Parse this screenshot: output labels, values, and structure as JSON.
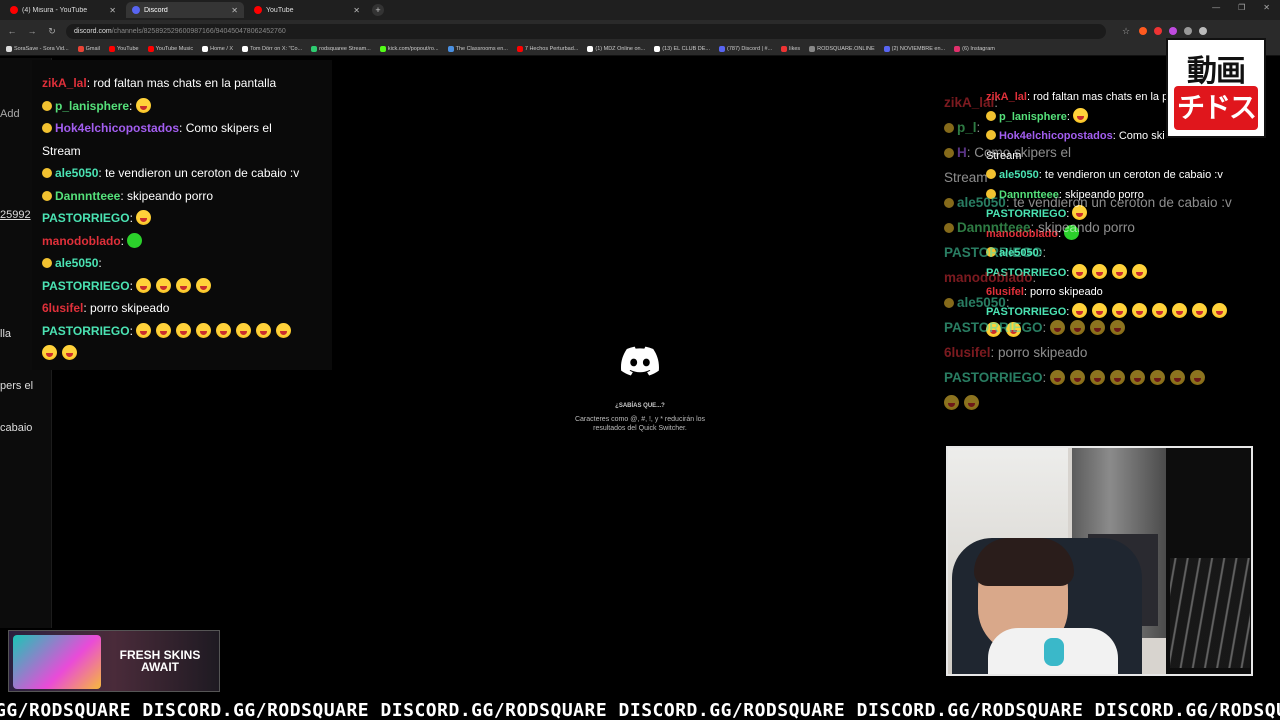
{
  "browser": {
    "tabs": [
      {
        "title": "(4) Misura - YouTube",
        "color": "#ff0000",
        "active": false
      },
      {
        "title": "Discord",
        "color": "#5865f2",
        "active": true
      },
      {
        "title": "YouTube",
        "color": "#ff0000",
        "active": false
      }
    ],
    "url_host": "discord.com",
    "url_path": "/channels/825892529600987166/940450478062452760",
    "bookmarks": [
      "SoraSave - Sora Vid...",
      "Gmail",
      "YouTube",
      "YouTube Music",
      "Home / X",
      "Tom Dörr on X: \"Co...",
      "rodsquaree Stream...",
      "kick.com/popout/ro...",
      "The Classrooms en...",
      "7 Hechos Perturbad...",
      "(1) MDZ Online on...",
      "(13) EL CLUB DE...",
      "(787) Discord | #...",
      "likes",
      "RODSQUARE.ONLINE",
      "(2) NOVIEMBRE en...",
      "(6) Instagram"
    ]
  },
  "left_strip": {
    "items": [
      "Add",
      "25992",
      "lla",
      "pers el",
      "cabaio"
    ]
  },
  "chat_left": [
    {
      "user": "zikA_lal",
      "color": "#e0303a",
      "badge": false,
      "msg": "rod faltan mas chats en la pantalla",
      "emotes": 0
    },
    {
      "user": "p_lanisphere",
      "color": "#55e07a",
      "badge": true,
      "msg": "",
      "emotes": 1
    },
    {
      "user": "Hok4elchicopostados",
      "color": "#a35ef0",
      "badge": true,
      "msg": "Como skipers el",
      "emotes": 0
    },
    {
      "user": "",
      "color": "#fff",
      "badge": false,
      "msg": "Stream",
      "emotes": 0
    },
    {
      "user": "ale5050",
      "color": "#4be3b3",
      "badge": true,
      "msg": "te vendieron un ceroton de cabaio :v",
      "emotes": 0
    },
    {
      "user": "Dannntteee",
      "color": "#55e07a",
      "badge": true,
      "msg": "skipeando porro",
      "emotes": 0
    },
    {
      "user": "PASTORRIEGO",
      "color": "#4be3b3",
      "badge": false,
      "msg": "",
      "emotes": 1
    },
    {
      "user": "manodoblado",
      "color": "#e0303a",
      "badge": false,
      "msg": "",
      "emotes": 1,
      "green": true
    },
    {
      "user": "ale5050",
      "color": "#4be3b3",
      "badge": true,
      "msg": "",
      "emotes": 0
    },
    {
      "user": "PASTORRIEGO",
      "color": "#4be3b3",
      "badge": false,
      "msg": "",
      "emotes": 4
    },
    {
      "user": "6lusifel",
      "color": "#e0303a",
      "badge": false,
      "msg": "porro skipeado",
      "emotes": 0
    },
    {
      "user": "PASTORRIEGO",
      "color": "#4be3b3",
      "badge": false,
      "msg": "",
      "emotes": 8
    },
    {
      "user": "",
      "color": "#fff",
      "badge": false,
      "msg": "",
      "emotes": 2
    }
  ],
  "discord": {
    "tip_title": "¿SABÍAS QUE...?",
    "tip_body": "Caracteres como @, #, !, y * reducirán los resultados del Quick Switcher."
  },
  "chat_right": [
    {
      "user": "zikA_lal",
      "color": "#e0303a",
      "badge": false,
      "msg": "",
      "emotes": 0
    },
    {
      "user": "p_l",
      "color": "#55e07a",
      "badge": true,
      "msg": "",
      "emotes": 0
    },
    {
      "user": "H",
      "color": "#a35ef0",
      "badge": true,
      "msg": "Como skipers el",
      "emotes": 0
    },
    {
      "user": "",
      "color": "#fff",
      "badge": false,
      "msg": "Stream",
      "emotes": 0
    },
    {
      "user": "ale5050",
      "color": "#4be3b3",
      "badge": true,
      "msg": "te vendieron un ceroton de cabaio :v",
      "emotes": 0
    },
    {
      "user": "Dannntteee",
      "color": "#55e07a",
      "badge": true,
      "msg": "skipeando porro",
      "emotes": 0
    },
    {
      "user": "PASTORRIEGO",
      "color": "#4be3b3",
      "badge": false,
      "msg": "",
      "emotes": 0
    },
    {
      "user": "manodoblado",
      "color": "#e0303a",
      "badge": false,
      "msg": "",
      "emotes": 0
    },
    {
      "user": "ale5050",
      "color": "#4be3b3",
      "badge": true,
      "msg": "",
      "emotes": 0
    },
    {
      "user": "PASTORRIEGO",
      "color": "#4be3b3",
      "badge": false,
      "msg": "",
      "emotes": 4
    },
    {
      "user": "6lusifel",
      "color": "#e0303a",
      "badge": false,
      "msg": "porro skipeado",
      "emotes": 0
    },
    {
      "user": "PASTORRIEGO",
      "color": "#4be3b3",
      "badge": false,
      "msg": "",
      "emotes": 8
    },
    {
      "user": "",
      "color": "#fff",
      "badge": false,
      "msg": "",
      "emotes": 2
    }
  ],
  "chat_ghost": [
    {
      "user": "zikA_lal",
      "color": "#e0303a",
      "badge": false,
      "msg": "rod faltan mas chats en la pa",
      "emotes": 0
    },
    {
      "user": "p_lanisphere",
      "color": "#55e07a",
      "badge": true,
      "msg": "",
      "emotes": 1
    },
    {
      "user": "Hok4elchicopostados",
      "color": "#a35ef0",
      "badge": true,
      "msg": "Como ski",
      "emotes": 0
    },
    {
      "user": "",
      "color": "#fff",
      "badge": false,
      "msg": "Stream",
      "emotes": 0
    },
    {
      "user": "ale5050",
      "color": "#4be3b3",
      "badge": true,
      "msg": "te vendieron un ceroton de cabaio :v",
      "emotes": 0
    },
    {
      "user": "Dannntteee",
      "color": "#55e07a",
      "badge": true,
      "msg": "skipeando porro",
      "emotes": 0
    },
    {
      "user": "PASTORRIEGO",
      "color": "#4be3b3",
      "badge": false,
      "msg": "",
      "emotes": 1
    },
    {
      "user": "manodoblado",
      "color": "#e0303a",
      "badge": false,
      "msg": "",
      "emotes": 1,
      "green": true
    },
    {
      "user": "ale5050",
      "color": "#4be3b3",
      "badge": true,
      "msg": "",
      "emotes": 0
    },
    {
      "user": "PASTORRIEGO",
      "color": "#4be3b3",
      "badge": false,
      "msg": "",
      "emotes": 4
    },
    {
      "user": "6lusifel",
      "color": "#e0303a",
      "badge": false,
      "msg": "porro skipeado",
      "emotes": 0
    },
    {
      "user": "PASTORRIEGO",
      "color": "#4be3b3",
      "badge": false,
      "msg": "",
      "emotes": 8
    },
    {
      "user": "",
      "color": "#fff",
      "badge": false,
      "msg": "",
      "emotes": 2
    }
  ],
  "logo": {
    "top": "動画",
    "bottom": "チドス"
  },
  "ad": {
    "text": "FRESH SKINS AWAIT"
  },
  "ticker": {
    "text": "GG/RODSQUARE DISCORD.GG/RODSQUARE DISCORD.GG/RODSQUARE DISCORD.GG/RODSQUARE DISCORD.GG/RODSQUARE DISCORD.GG/RODSQUARE"
  }
}
